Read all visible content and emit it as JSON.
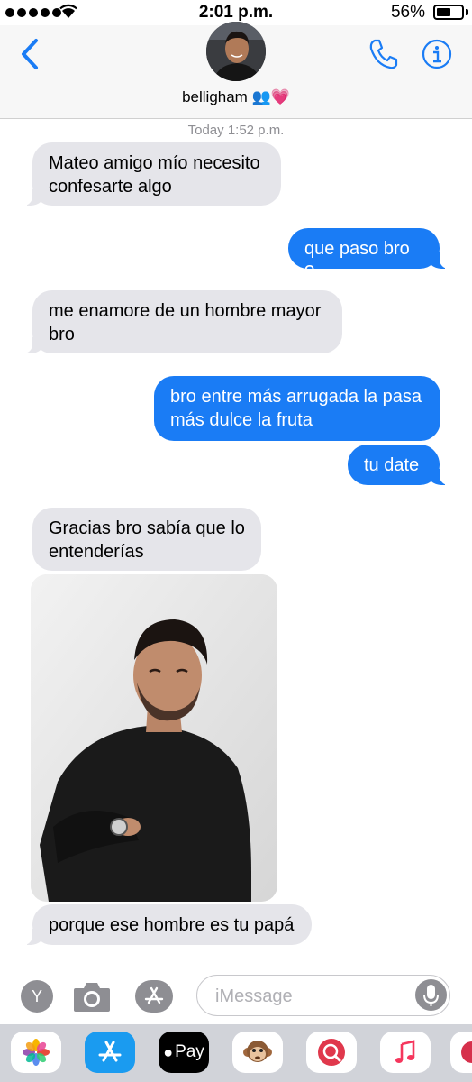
{
  "status_bar": {
    "time": "2:01 p.m.",
    "battery": "56%",
    "battery_level": 0.56
  },
  "header": {
    "contact_name": "belligham 👥💗"
  },
  "conversation": {
    "timestamp": "Today 1:52 p.m.",
    "messages": [
      {
        "from": "them",
        "text": "Mateo amigo mío necesito confesarte algo"
      },
      {
        "from": "me",
        "text": "que paso bro ?"
      },
      {
        "from": "them",
        "text": "me enamore de un hombre mayor bro"
      },
      {
        "from": "me",
        "text": "bro entre más arrugada la pasa más dulce la fruta"
      },
      {
        "from": "me",
        "text": "tu date"
      },
      {
        "from": "them",
        "text": "Gracias bro sabía que lo entenderías"
      },
      {
        "from": "them",
        "type": "photo"
      },
      {
        "from": "them",
        "text": "porque ese hombre es tu papá"
      }
    ]
  },
  "input": {
    "placeholder": "iMessage",
    "y_label": "Y"
  },
  "drawer": {
    "apps": [
      {
        "icon": "photos-icon"
      },
      {
        "icon": "app-store-icon"
      },
      {
        "icon": "apple-pay-icon",
        "label": "Pay"
      },
      {
        "icon": "animoji-monkey-icon"
      },
      {
        "icon": "search-images-icon"
      },
      {
        "icon": "music-icon"
      },
      {
        "icon": "more-apps-icon"
      }
    ]
  },
  "colors": {
    "outgoing": "#1a7cf5",
    "incoming": "#e5e5ea",
    "accent": "#1a7cf5"
  }
}
